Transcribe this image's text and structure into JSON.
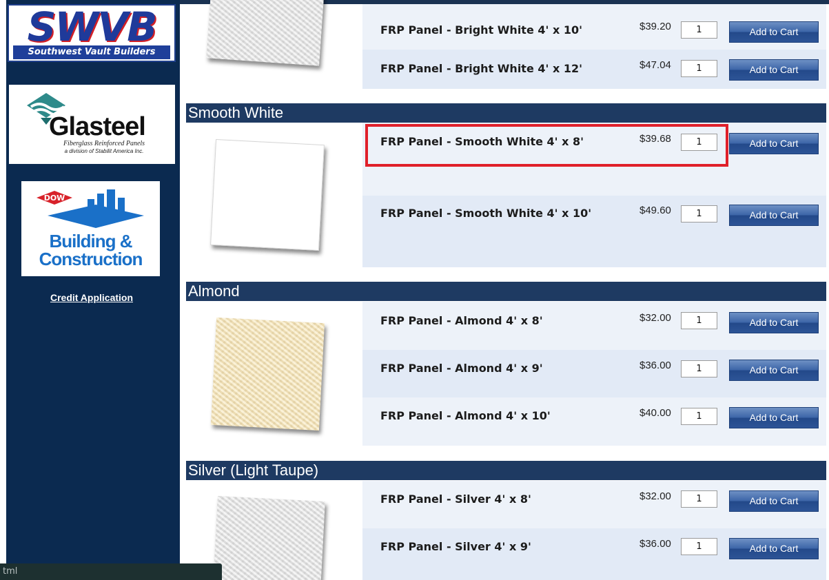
{
  "sidebar": {
    "swvb_logo": {
      "letters": "SWVB",
      "subtitle": "Southwest Vault Builders"
    },
    "glasteel_logo": {
      "name": "Glasteel",
      "tagline1": "Fiberglass Reinforced Panels",
      "tagline2": "a division of Stabilit America Inc."
    },
    "dow_logo": {
      "badge": "DOW",
      "line1": "Building &",
      "line2": "Construction"
    },
    "credit_link": "Credit Application"
  },
  "add_label": "Add to Cart",
  "categories": [
    {
      "name": "Smooth White"
    },
    {
      "name": "Almond"
    },
    {
      "name": "Silver (Light Taupe)"
    }
  ],
  "products": {
    "bright_white_10": {
      "name": "FRP Panel - Bright White 4' x 10'",
      "price": "$39.20",
      "qty": "1"
    },
    "bright_white_12": {
      "name": "FRP Panel - Bright White 4' x 12'",
      "price": "$47.04",
      "qty": "1"
    },
    "smooth_white_8": {
      "name": "FRP Panel - Smooth White 4' x 8'",
      "price": "$39.68",
      "qty": "1"
    },
    "smooth_white_10": {
      "name": "FRP Panel - Smooth White 4' x 10'",
      "price": "$49.60",
      "qty": "1"
    },
    "almond_8": {
      "name": "FRP Panel - Almond 4' x 8'",
      "price": "$32.00",
      "qty": "1"
    },
    "almond_9": {
      "name": "FRP Panel - Almond 4' x 9'",
      "price": "$36.00",
      "qty": "1"
    },
    "almond_10": {
      "name": "FRP Panel - Almond 4' x 10'",
      "price": "$40.00",
      "qty": "1"
    },
    "silver_8": {
      "name": "FRP Panel - Silver 4' x 8'",
      "price": "$32.00",
      "qty": "1"
    },
    "silver_9": {
      "name": "FRP Panel - Silver 4' x 9'",
      "price": "$36.00",
      "qty": "1"
    }
  },
  "status_bar": "tml",
  "colors": {
    "sidebar": "#0b2a50",
    "header": "#1e3a62",
    "highlight": "#e0202a",
    "button": "#2d5496"
  }
}
